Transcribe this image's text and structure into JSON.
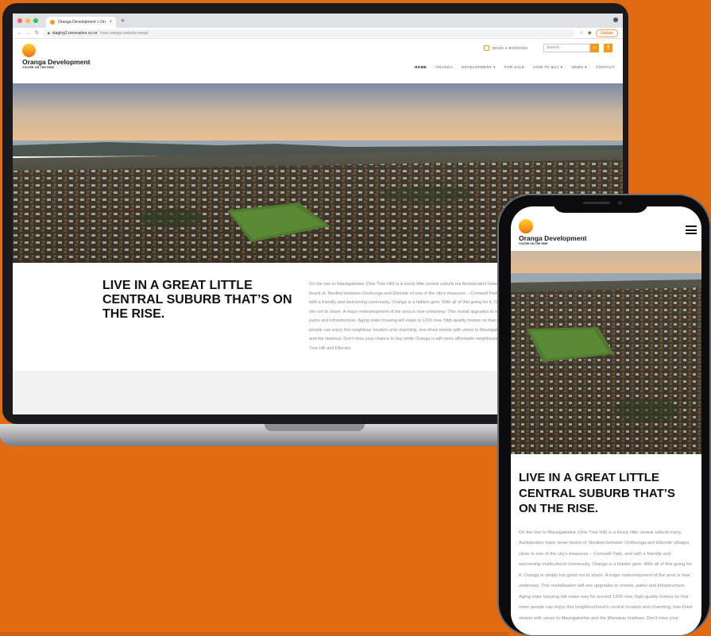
{
  "browser": {
    "tab_title": "Oranga Development » Orang",
    "tab_close": "×",
    "new_tab": "+",
    "url_host": "staging2.renovation.co.nz",
    "url_path": "/new-oranga-website-swap/",
    "update_label": "Update"
  },
  "site": {
    "brand": "Oranga Development",
    "tagline": "YOU'RE ON THE RISE",
    "booking_label": "MAKE A BOOKING",
    "search_placeholder": "Search..",
    "facebook_icon": "f",
    "nav": [
      "HOME",
      "ORANGA",
      "DEVELOPMENT ▾",
      "FOR SALE",
      "HOW TO BUY ▾",
      "NEWS ▾",
      "CONTACT"
    ],
    "nav_active": "HOME"
  },
  "intro": {
    "heading": "LIVE IN A GREAT LITTLE CENTRAL SUBURB THAT’S ON THE RISE.",
    "body_desktop": "On the rise to Maungakiekie (One Tree Hill) is a lovely little central suburb ma Aucklanders have never heard of. Nestled between Onehunga and Ellerslie vil one of the city's treasures – Cornwall Park, and with a friendly and welcoming community, Oranga is a hidden gem. With all of this going for it, Oranga is sim not to share. A major redevelopment of the area is now underway. This revital upgrades to streets, parks and infrastructure. Aging state housing will make w 1200 new, high-quality homes so that more people can enjoy this neighbour location and charming, tree-lined streets with views to Maungakiekie and the Harbour. Don't miss your chance to buy while Oranga is still more affordable neighbours, One Tree Hill and Ellerslie.",
    "body_mobile": "On the rise to Maungakiekie (One Tree Hill) is a lovely little central suburb many Aucklanders have never heard of. Nestled between Onehunga and Ellerslie villages, close to one of the city's treasures – Cornwall Park, and with a friendly and welcoming multicultural community, Oranga is a hidden gem. With all of this going for it, Oranga is simply too good not to share. A major redevelopment of the area is now underway. This revitalisation will see upgrades to streets, parks and infrastructure. Aging state housing will make way for around 1200 new, high-quality homes so that more people can enjoy this neighbourhood's central location and charming, tree-lined streets with views to Maungakiekie and the Manukau Harbour. Don't miss your"
  },
  "colors": {
    "background": "#e06b12",
    "accent": "#f59a1d"
  }
}
